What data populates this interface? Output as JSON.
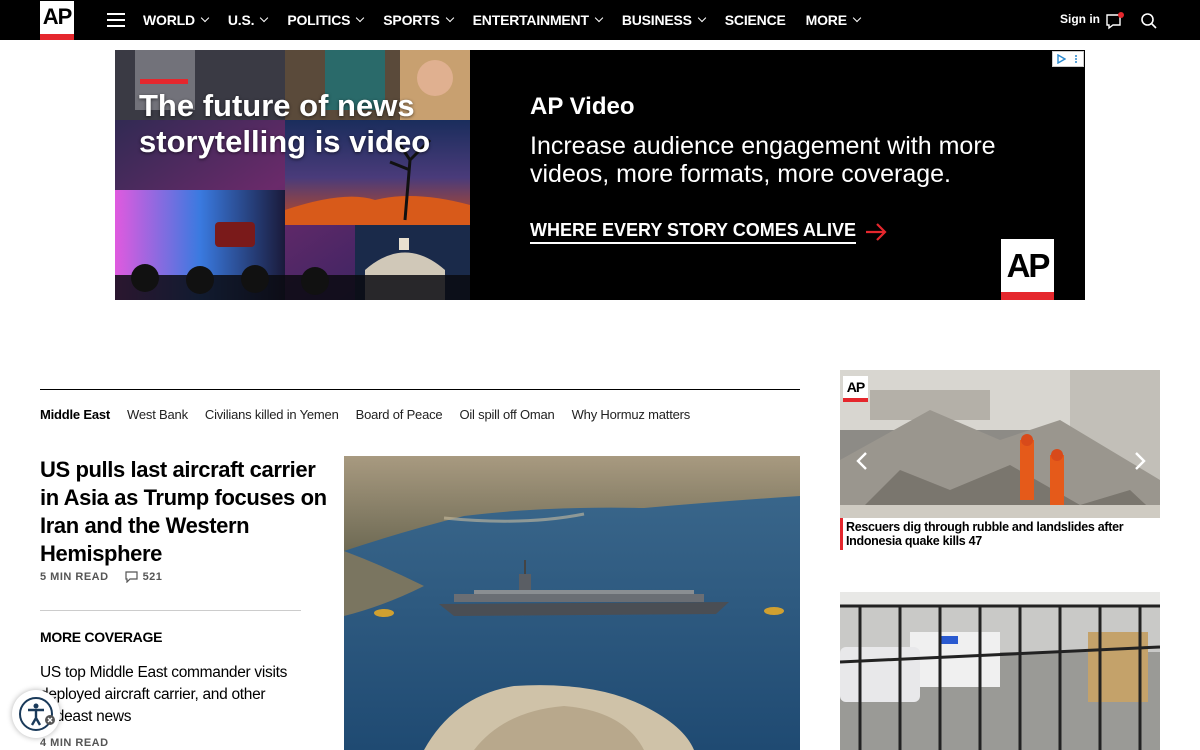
{
  "nav": {
    "logo": "AP",
    "items": [
      "WORLD",
      "U.S.",
      "POLITICS",
      "SPORTS",
      "ENTERTAINMENT",
      "BUSINESS",
      "SCIENCE",
      "MORE"
    ],
    "sign_in": "Sign in",
    "icons": [
      "menu-icon",
      "messages-icon",
      "search-icon"
    ]
  },
  "ad": {
    "headline": "The future of news storytelling is video",
    "title": "AP Video",
    "body": "Increase audience engagement with more videos, more formats, more coverage.",
    "cta": "WHERE EVERY STORY COMES ALIVE",
    "logo": "AP"
  },
  "topics": [
    "Middle East",
    "West Bank",
    "Civilians killed in Yemen",
    "Board of Peace",
    "Oil spill off Oman",
    "Why Hormuz matters"
  ],
  "lead": {
    "headline": "US pulls last aircraft carrier in Asia as Trump focuses on Iran and the Western Hemisphere",
    "read_time": "5 MIN READ",
    "comments": "521"
  },
  "more_coverage": {
    "label": "MORE COVERAGE",
    "headline": "US top Middle East commander visits deployed aircraft carrier, and other Mideast news",
    "read_time": "4 MIN READ"
  },
  "right": {
    "bug": "AP",
    "caption": "Rescuers dig through rubble and landslides after Indonesia quake kills 47"
  },
  "colors": {
    "brand_red": "#e5272d",
    "nav_bg": "#000000"
  }
}
